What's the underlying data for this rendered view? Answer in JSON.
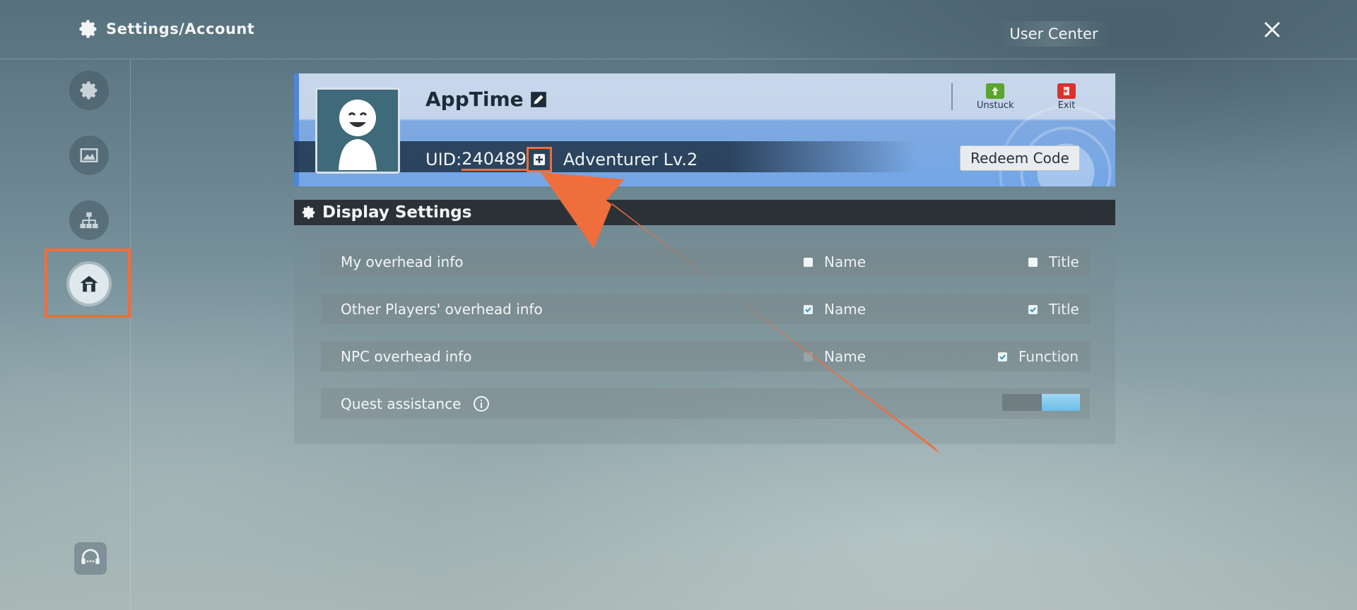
{
  "header": {
    "title": "Settings/Account",
    "user_center_label": "User Center",
    "close_icon": "close-icon"
  },
  "sidebar": {
    "items": [
      {
        "icon": "gear-icon",
        "active": false
      },
      {
        "icon": "image-icon",
        "active": false
      },
      {
        "icon": "hierarchy-icon",
        "active": false
      },
      {
        "icon": "home-icon",
        "active": true
      }
    ],
    "support_icon": "headset-icon"
  },
  "profile": {
    "username": "AppTime",
    "uid_label": "UID:",
    "uid_value": "240489",
    "rank": "Adventurer Lv.2",
    "actions": {
      "unstuck_label": "Unstuck",
      "exit_label": "Exit"
    },
    "redeem_label": "Redeem Code"
  },
  "display_settings": {
    "title": "Display Settings",
    "rows": [
      {
        "label": "My overhead info",
        "options": [
          {
            "label": "Name",
            "checked": false
          },
          {
            "label": "Title",
            "checked": false
          }
        ]
      },
      {
        "label": "Other Players' overhead info",
        "options": [
          {
            "label": "Name",
            "checked": true
          },
          {
            "label": "Title",
            "checked": true
          }
        ]
      },
      {
        "label": "NPC overhead info",
        "options": [
          {
            "label": "Name",
            "checked": false
          },
          {
            "label": "Function",
            "checked": true
          }
        ]
      },
      {
        "label": "Quest assistance",
        "toggle_on": true
      }
    ]
  },
  "colors": {
    "annotation": "#ef6e3c",
    "toggle_on": "#6cbde8"
  }
}
